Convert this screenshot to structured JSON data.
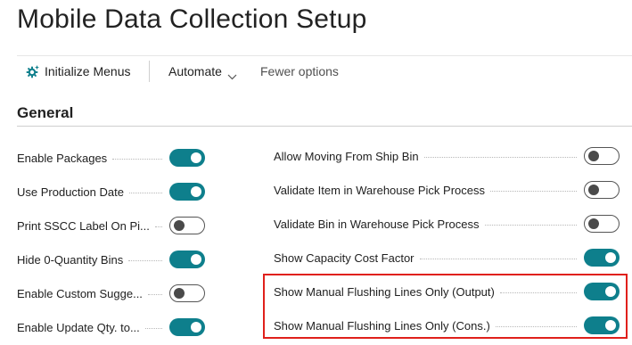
{
  "page": {
    "title": "Mobile Data Collection Setup"
  },
  "actions": {
    "initialize_menus": "Initialize Menus",
    "automate": "Automate",
    "fewer_options": "Fewer options"
  },
  "section": {
    "title": "General"
  },
  "left_fields": [
    {
      "label": "Enable Packages",
      "enabled": true
    },
    {
      "label": "Use Production Date",
      "enabled": true
    },
    {
      "label": "Print SSCC Label On Pi...",
      "enabled": false
    },
    {
      "label": "Hide 0-Quantity Bins",
      "enabled": true
    },
    {
      "label": "Enable Custom Sugge...",
      "enabled": false
    },
    {
      "label": "Enable Update Qty. to...",
      "enabled": true
    }
  ],
  "right_fields": [
    {
      "label": "Allow Moving From Ship Bin",
      "enabled": false
    },
    {
      "label": "Validate Item in Warehouse Pick Process",
      "enabled": false
    },
    {
      "label": "Validate Bin in Warehouse Pick Process",
      "enabled": false
    },
    {
      "label": "Show Capacity Cost Factor",
      "enabled": true
    },
    {
      "label": "Show Manual Flushing Lines Only (Output)",
      "enabled": true
    },
    {
      "label": "Show Manual Flushing Lines Only (Cons.)",
      "enabled": true
    }
  ],
  "colors": {
    "toggle_on": "#0e7f8c",
    "highlight": "#e0201b"
  },
  "icons": {
    "initialize": "gear-sparkle-icon",
    "automate_dropdown": "chevron-down-icon"
  }
}
